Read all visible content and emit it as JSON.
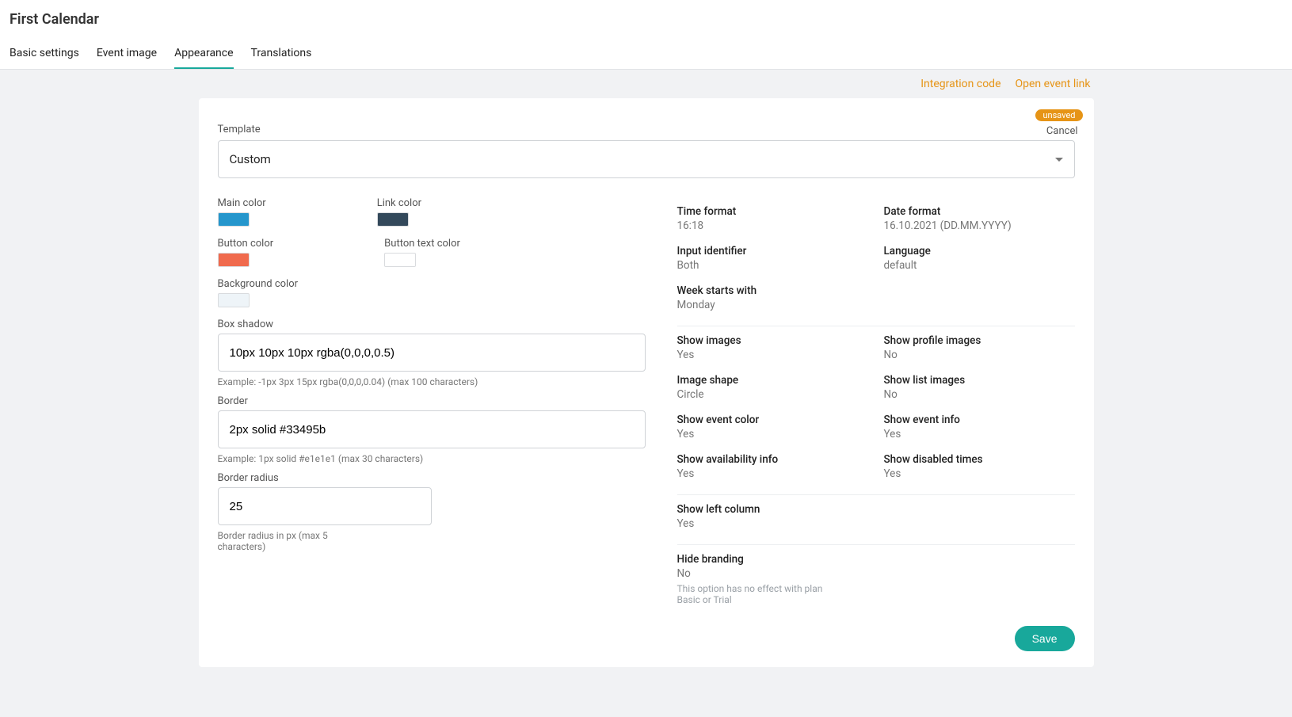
{
  "header": {
    "title": "First Calendar",
    "tabs": [
      "Basic settings",
      "Event image",
      "Appearance",
      "Translations"
    ],
    "activeTab": "Appearance"
  },
  "topLinks": {
    "integration": "Integration code",
    "openEvent": "Open event link"
  },
  "card": {
    "unsaved": "unsaved",
    "cancel": "Cancel",
    "templateLabel": "Template",
    "templateValue": "Custom",
    "colors": {
      "mainLabel": "Main color",
      "mainColor": "#2596cc",
      "linkLabel": "Link color",
      "linkColor": "#33495b",
      "buttonLabel": "Button color",
      "buttonColor": "#f06a4d",
      "buttonTextLabel": "Button text color",
      "buttonTextColor": "#ffffff",
      "bgLabel": "Background color",
      "bgColor": "#eef4f8"
    },
    "boxShadow": {
      "label": "Box shadow",
      "value": "10px 10px 10px rgba(0,0,0,0.5)",
      "helper": "Example: -1px 3px 15px rgba(0,0,0,0.04) (max 100 characters)"
    },
    "border": {
      "label": "Border",
      "value": "2px solid #33495b",
      "helper": "Example: 1px solid #e1e1e1 (max 30 characters)"
    },
    "borderRadius": {
      "label": "Border radius",
      "value": "25",
      "helper": "Border radius in px (max 5 characters)"
    },
    "settings": {
      "group1": [
        {
          "label": "Time format",
          "value": "16:18"
        },
        {
          "label": "Date format",
          "value": "16.10.2021 (DD.MM.YYYY)"
        },
        {
          "label": "Input identifier",
          "value": "Both"
        },
        {
          "label": "Language",
          "value": "default"
        },
        {
          "label": "Week starts with",
          "value": "Monday"
        }
      ],
      "group2": [
        {
          "label": "Show images",
          "value": "Yes"
        },
        {
          "label": "Show profile images",
          "value": "No"
        },
        {
          "label": "Image shape",
          "value": "Circle"
        },
        {
          "label": "Show list images",
          "value": "No"
        },
        {
          "label": "Show event color",
          "value": "Yes"
        },
        {
          "label": "Show event info",
          "value": "Yes"
        },
        {
          "label": "Show availability info",
          "value": "Yes"
        },
        {
          "label": "Show disabled times",
          "value": "Yes"
        }
      ],
      "group3": [
        {
          "label": "Show left column",
          "value": "Yes"
        }
      ],
      "group4": [
        {
          "label": "Hide branding",
          "value": "No",
          "note": "This option has no effect with plan Basic or Trial"
        }
      ]
    },
    "saveLabel": "Save"
  }
}
